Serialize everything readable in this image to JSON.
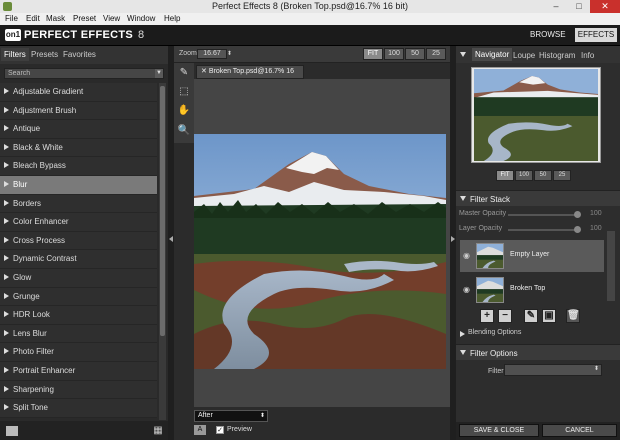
{
  "window": {
    "title": "Perfect Effects 8 (Broken Top.psd@16.7% 16 bit)",
    "minimize": "–",
    "maximize": "□",
    "close": "✕"
  },
  "menu": [
    "File",
    "Edit",
    "Mask",
    "Preset",
    "View",
    "Window",
    "Help"
  ],
  "header": {
    "logo_mark": "on1",
    "logo_text": "PERFECT EFFECTS",
    "version": "8",
    "browse": "BROWSE",
    "effects": "EFFECTS"
  },
  "left": {
    "tabs": [
      "Filters",
      "Presets",
      "Favorites"
    ],
    "search_placeholder": "Search",
    "filters": [
      "Adjustable Gradient",
      "Adjustment Brush",
      "Antique",
      "Black & White",
      "Bleach Bypass",
      "Blur",
      "Borders",
      "Color Enhancer",
      "Cross Process",
      "Dynamic Contrast",
      "Glow",
      "Grunge",
      "HDR Look",
      "Lens Blur",
      "Photo Filter",
      "Portrait Enhancer",
      "Sharpening",
      "Split Tone"
    ],
    "selected": "Blur"
  },
  "center": {
    "zoom_label": "Zoom",
    "zoom_value": "16.67",
    "zoom_buttons": [
      "FIT",
      "100",
      "50",
      "25"
    ],
    "doc_tab": "Broken Top.psd@16.7% 16 bit",
    "view_mode": "After",
    "a_label": "A",
    "preview_label": "Preview"
  },
  "right": {
    "tabs": [
      "Navigator",
      "Loupe",
      "Histogram",
      "Info"
    ],
    "nav_zoom": [
      "FIT",
      "100",
      "50",
      "25"
    ],
    "filter_stack": {
      "title": "Filter Stack",
      "master_opacity": "Master Opacity",
      "master_value": "100",
      "layer_opacity": "Layer Opacity",
      "layer_value": "100",
      "layers": [
        "Empty Layer",
        "Broken Top"
      ],
      "blending": "Blending Options"
    },
    "filter_options": {
      "title": "Filter Options",
      "filter_label": "Filter"
    },
    "save": "SAVE & CLOSE",
    "cancel": "CANCEL"
  },
  "colors": {
    "accent": "#7a7a7a",
    "panel": "#2a2a2a",
    "header": "#1b1b1b"
  }
}
